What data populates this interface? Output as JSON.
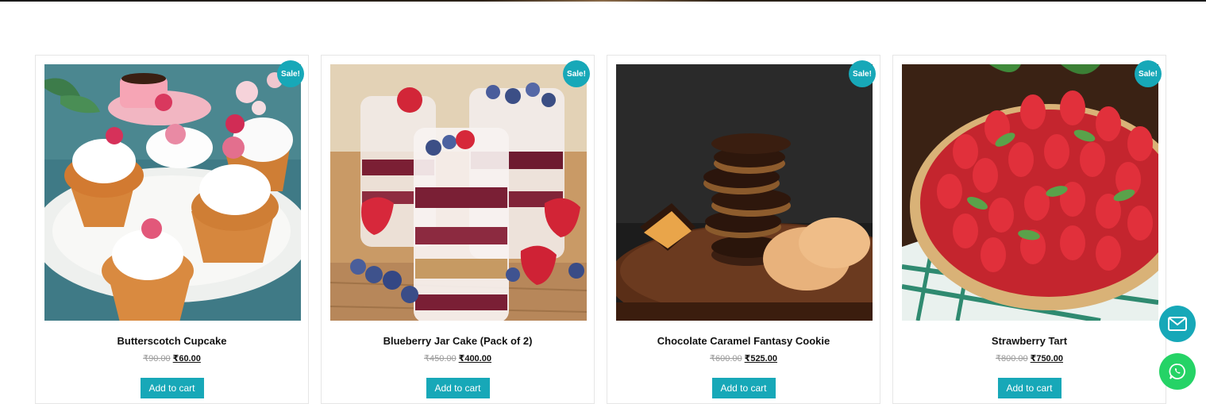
{
  "products": [
    {
      "title": "Butterscotch Cupcake",
      "badge": "Sale!",
      "regular_price": "₹90.00",
      "sale_price": "₹60.00",
      "cta": "Add to cart",
      "image": "cupcakes-photo"
    },
    {
      "title": "Blueberry Jar Cake (Pack of 2)",
      "badge": "Sale!",
      "regular_price": "₹450.00",
      "sale_price": "₹400.00",
      "cta": "Add to cart",
      "image": "jar-cake-photo"
    },
    {
      "title": "Chocolate Caramel Fantasy Cookie",
      "badge": "Sale!",
      "regular_price": "₹600.00",
      "sale_price": "₹525.00",
      "cta": "Add to cart",
      "image": "cookie-stack-photo"
    },
    {
      "title": "Strawberry Tart",
      "badge": "Sale!",
      "regular_price": "₹800.00",
      "sale_price": "₹750.00",
      "cta": "Add to cart",
      "image": "strawberry-tart-photo"
    }
  ],
  "floating": {
    "mail_icon": "mail-icon",
    "whatsapp_icon": "whatsapp-icon"
  },
  "colors": {
    "accent": "#17a8b8",
    "whatsapp": "#25d366",
    "sale_badge": "#17a8b8"
  }
}
